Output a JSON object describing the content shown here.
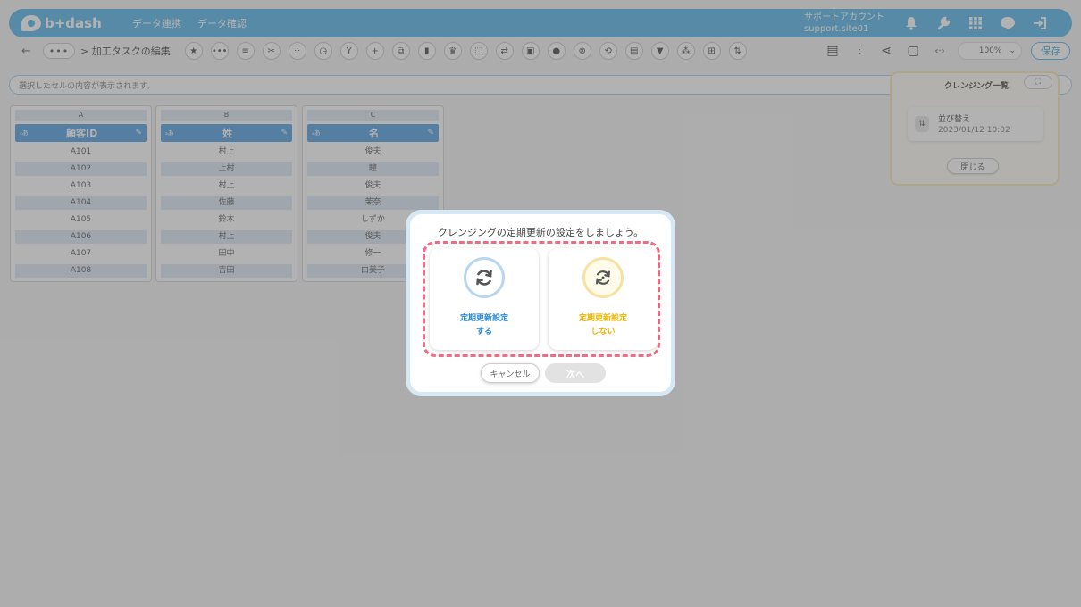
{
  "header": {
    "logo": "b+dash",
    "nav": [
      "データ連携",
      "データ確認"
    ],
    "account_line1": "サポートアカウント",
    "account_line2": "support.site01",
    "icons": [
      "bell-icon",
      "wrench-icon",
      "apps-icon",
      "chat-icon",
      "logout-icon"
    ]
  },
  "toolbar": {
    "back": "←",
    "more": "•••",
    "breadcrumb": "> 加工タスクの編集",
    "zoom": "100%",
    "zoom_caret": "⌄",
    "save": "保存"
  },
  "cellbar": {
    "placeholder": "選択したセルの内容が表示されます。"
  },
  "columns": [
    {
      "letter": "A",
      "type": "ₐあ",
      "name": "顧客ID",
      "cells": [
        "A101",
        "A102",
        "A103",
        "A104",
        "A105",
        "A106",
        "A107",
        "A108"
      ]
    },
    {
      "letter": "B",
      "type": "ₐあ",
      "name": "姓",
      "cells": [
        "村上",
        "上村",
        "村上",
        "佐藤",
        "鈴木",
        "村上",
        "田中",
        "吉田"
      ]
    },
    {
      "letter": "C",
      "type": "ₐあ",
      "name": "名",
      "cells": [
        "俊夫",
        "瞳",
        "俊夫",
        "茉奈",
        "しずか",
        "俊夫",
        "修一",
        "由美子"
      ]
    }
  ],
  "right_panel": {
    "title": "クレンジング一覧",
    "card_label": "並び替え",
    "card_date": "2023/01/12 10:02",
    "close": "閉じる"
  },
  "modal": {
    "title": "クレンジングの定期更新の設定をしましょう。",
    "yes_line1": "定期更新設定",
    "yes_line2": "する",
    "no_line1": "定期更新設定",
    "no_line2": "しない",
    "cancel": "キャンセル",
    "next": "次へ",
    "colors": {
      "yes": "#2c8bd6",
      "no": "#f0b400",
      "dashed": "#ef6d84"
    }
  }
}
